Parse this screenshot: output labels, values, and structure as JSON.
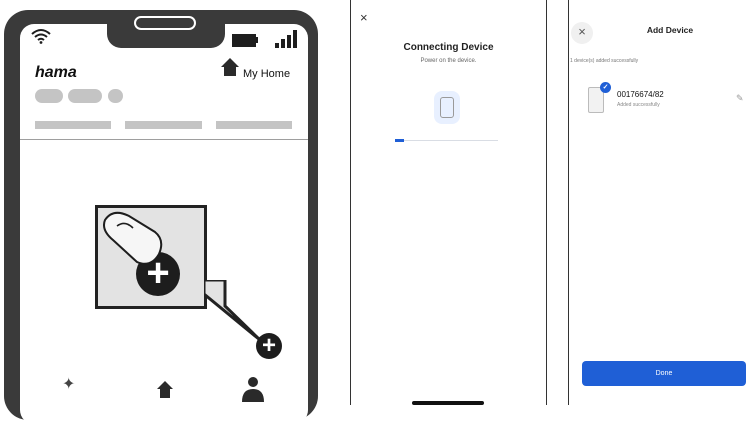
{
  "illustration": {
    "brand": "hama",
    "home_label": "My Home",
    "add_symbol": "+",
    "icons": [
      "wifi-icon",
      "battery-icon",
      "signal-icon",
      "home-icon",
      "finger-icon",
      "plus-icon",
      "sparkle-icon",
      "person-icon"
    ]
  },
  "connecting_screen": {
    "close_label": "×",
    "title": "Connecting Device",
    "subtitle": "Power on the device.",
    "progress": 0.09,
    "accent_color": "#1f5fd6"
  },
  "add_device_screen": {
    "close_label": "×",
    "title": "Add Device",
    "note": "1 device(s) added successfully",
    "device": {
      "name": "00176674/82",
      "status": "Added successfully"
    },
    "done_label": "Done",
    "accent_color": "#1f5fd6"
  }
}
